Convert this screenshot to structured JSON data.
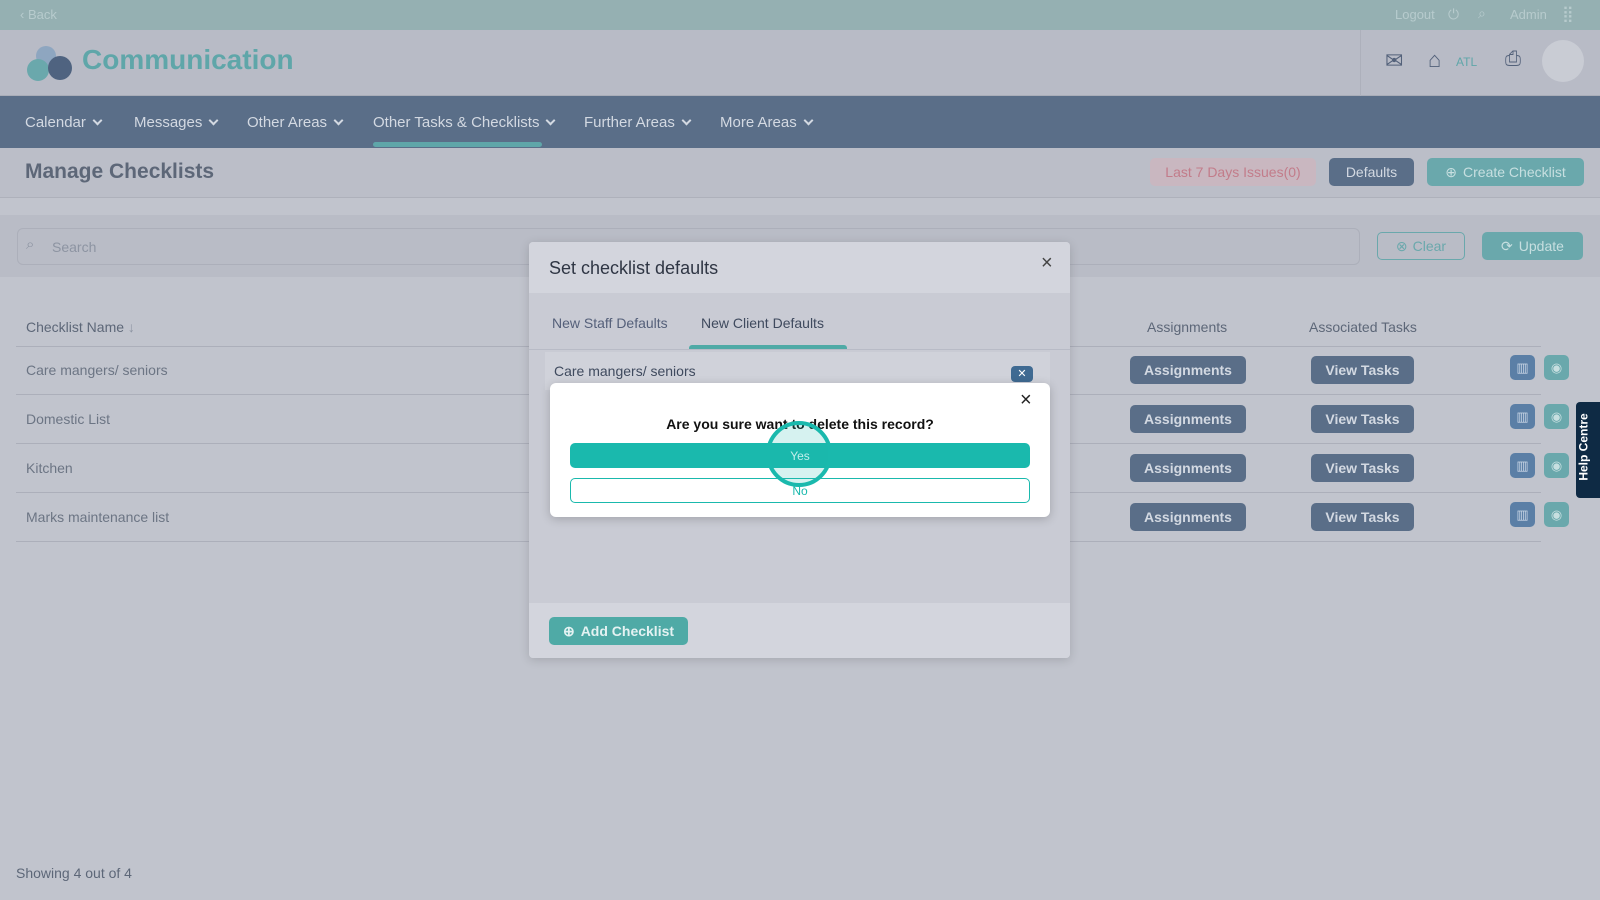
{
  "topbar": {
    "back": "‹ Back",
    "logout": "Logout",
    "admin": "Admin"
  },
  "header": {
    "app_title": "Communication",
    "home_label": "ATL"
  },
  "nav": {
    "items": [
      {
        "label": "Calendar"
      },
      {
        "label": "Messages"
      },
      {
        "label": "Other Areas"
      },
      {
        "label": "Other Tasks & Checklists",
        "active": true
      },
      {
        "label": "Further Areas"
      },
      {
        "label": "More Areas"
      }
    ]
  },
  "page": {
    "title": "Manage Checklists",
    "issues_button": "Last 7 Days Issues(0)",
    "defaults_button": "Defaults",
    "create_button": "Create Checklist"
  },
  "filter": {
    "search_placeholder": "Search",
    "clear": "Clear",
    "update": "Update"
  },
  "table": {
    "columns": [
      "Checklist Name",
      "Assignments",
      "Associated Tasks"
    ],
    "rows": [
      {
        "name": "Care mangers/ seniors",
        "assignments": "Assignments",
        "tasks": "View Tasks"
      },
      {
        "name": "Domestic List",
        "assignments": "Assignments",
        "tasks": "View Tasks"
      },
      {
        "name": "Kitchen",
        "assignments": "Assignments",
        "tasks": "View Tasks"
      },
      {
        "name": "Marks maintenance list",
        "assignments": "Assignments",
        "tasks": "View Tasks"
      }
    ]
  },
  "footer": {
    "showing": "Showing 4 out of 4"
  },
  "help_centre": "Help Centre",
  "modal": {
    "title": "Set checklist defaults",
    "tabs": [
      "New Staff Defaults",
      "New Client Defaults"
    ],
    "active_tab": 1,
    "item": "Care mangers/ seniors",
    "add_button": "Add Checklist"
  },
  "confirm": {
    "question": "Are you sure want to delete this record?",
    "yes": "Yes",
    "no": "No"
  },
  "colors": {
    "accent": "#1ab9ad",
    "nav": "#5a6e88"
  }
}
